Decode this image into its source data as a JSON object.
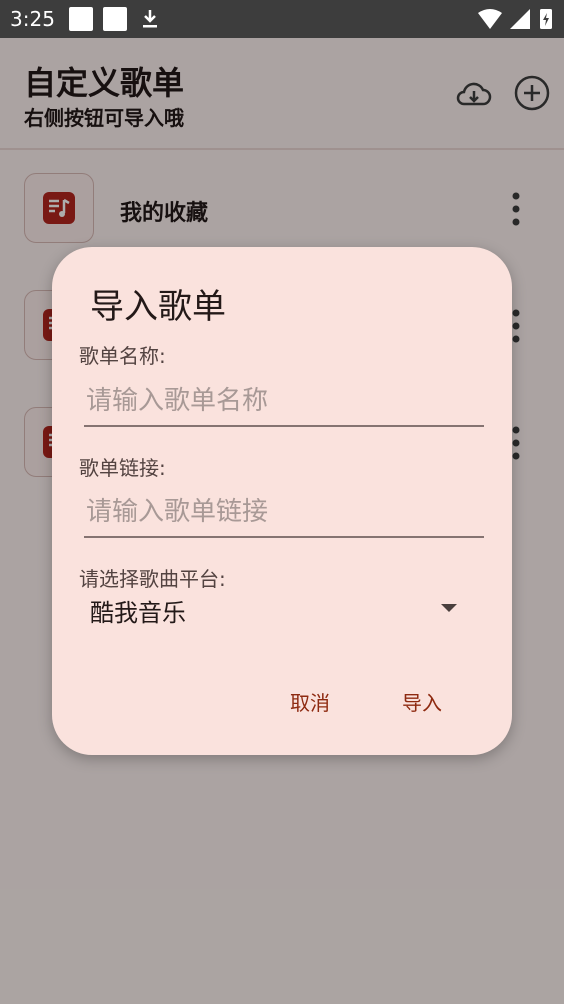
{
  "status_bar": {
    "time": "3:25"
  },
  "header": {
    "title": "自定义歌单",
    "subtitle": "右侧按钮可导入哦"
  },
  "list": {
    "items": [
      {
        "label": "我的收藏"
      },
      {
        "label": ""
      },
      {
        "label": ""
      }
    ]
  },
  "dialog": {
    "title": "导入歌单",
    "name_label": "歌单名称:",
    "name_placeholder": "请输入歌单名称",
    "link_label": "歌单链接:",
    "link_placeholder": "请输入歌单链接",
    "platform_label": "请选择歌曲平台:",
    "platform_selected": "酷我音乐",
    "cancel_label": "取消",
    "import_label": "导入"
  },
  "colors": {
    "accent": "#b3261e",
    "dialog_bg": "#fae2dd",
    "button_text": "#8e2a10"
  }
}
